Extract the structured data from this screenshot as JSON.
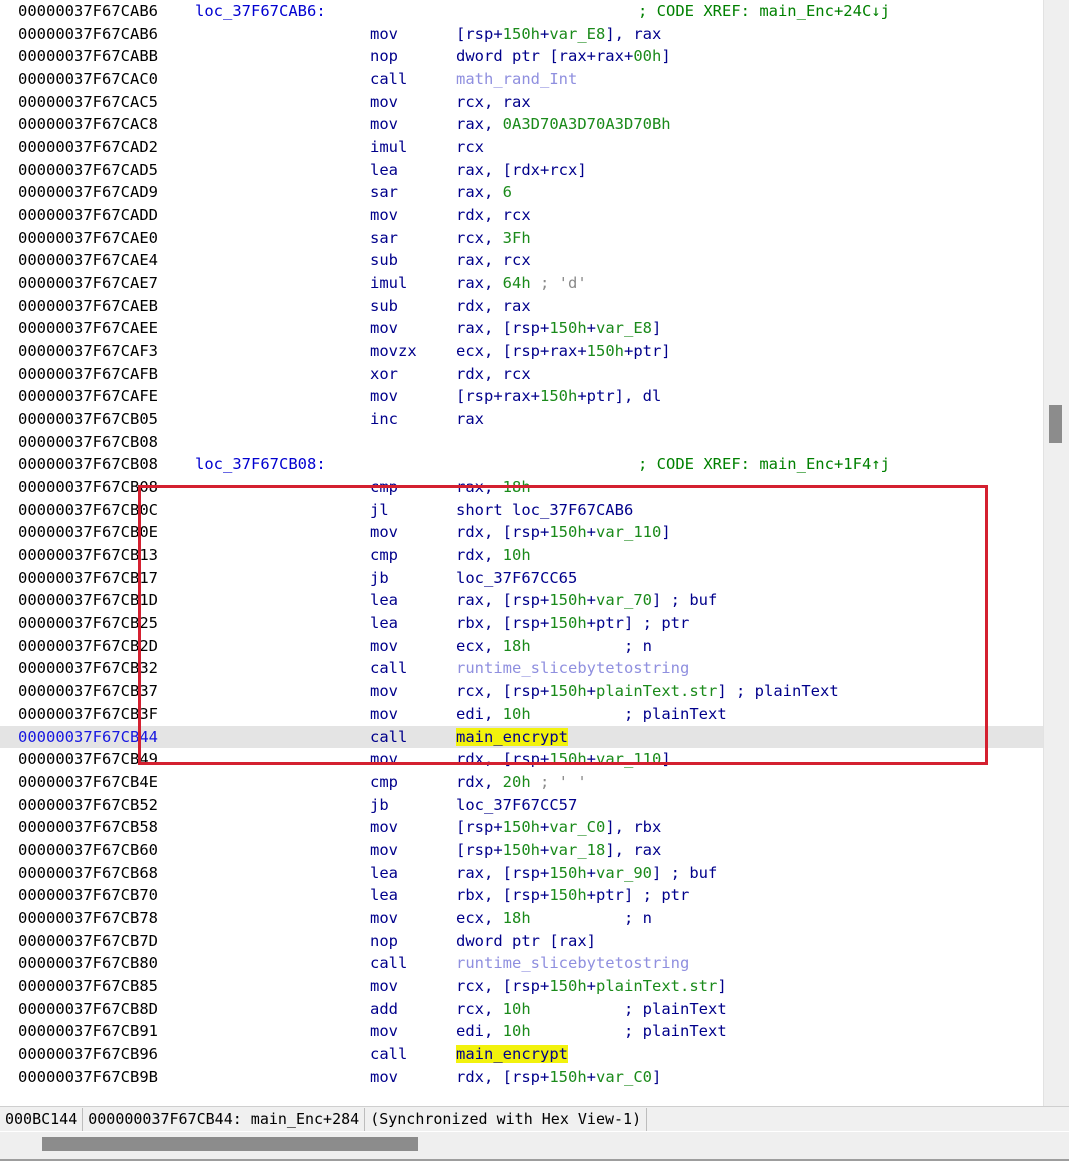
{
  "window": {
    "kind": "disassembly-listing"
  },
  "statusbar": {
    "file_offset": "000BC144",
    "location": "000000037F67CB44: main_Enc+284",
    "sync": "(Synchronized with Hex View-1)"
  },
  "annotation": {
    "box_color": "#d42030",
    "highlight_color": "#f2f20d",
    "current_line_color": "#e4e4e4"
  },
  "listing": [
    {
      "addr": "00000037F67CAB6",
      "label": "loc_37F67CAB6:",
      "mnem": "",
      "ops": "",
      "xref": "; CODE XREF: main_Enc+24C↓j"
    },
    {
      "addr": "00000037F67CAB6",
      "label": "",
      "mnem": "mov",
      "ops": "[rsp+150h+var_E8], rax",
      "xref": ""
    },
    {
      "addr": "00000037F67CABB",
      "label": "",
      "mnem": "nop",
      "ops": "dword ptr [rax+rax+00h]",
      "xref": ""
    },
    {
      "addr": "00000037F67CAC0",
      "label": "",
      "mnem": "call",
      "ops": "math_rand_Int",
      "xref": "",
      "optype": "ext"
    },
    {
      "addr": "00000037F67CAC5",
      "label": "",
      "mnem": "mov",
      "ops": "rcx, rax",
      "xref": ""
    },
    {
      "addr": "00000037F67CAC8",
      "label": "",
      "mnem": "mov",
      "ops": "rax, 0A3D70A3D70A3D70Bh",
      "xref": ""
    },
    {
      "addr": "00000037F67CAD2",
      "label": "",
      "mnem": "imul",
      "ops": "rcx",
      "xref": ""
    },
    {
      "addr": "00000037F67CAD5",
      "label": "",
      "mnem": "lea",
      "ops": "rax, [rdx+rcx]",
      "xref": ""
    },
    {
      "addr": "00000037F67CAD9",
      "label": "",
      "mnem": "sar",
      "ops": "rax, 6",
      "xref": ""
    },
    {
      "addr": "00000037F67CADD",
      "label": "",
      "mnem": "mov",
      "ops": "rdx, rcx",
      "xref": ""
    },
    {
      "addr": "00000037F67CAE0",
      "label": "",
      "mnem": "sar",
      "ops": "rcx, 3Fh",
      "xref": ""
    },
    {
      "addr": "00000037F67CAE4",
      "label": "",
      "mnem": "sub",
      "ops": "rax, rcx",
      "xref": ""
    },
    {
      "addr": "00000037F67CAE7",
      "label": "",
      "mnem": "imul",
      "ops": "rax, 64h ; 'd'",
      "xref": ""
    },
    {
      "addr": "00000037F67CAEB",
      "label": "",
      "mnem": "sub",
      "ops": "rdx, rax",
      "xref": ""
    },
    {
      "addr": "00000037F67CAEE",
      "label": "",
      "mnem": "mov",
      "ops": "rax, [rsp+150h+var_E8]",
      "xref": ""
    },
    {
      "addr": "00000037F67CAF3",
      "label": "",
      "mnem": "movzx",
      "ops": "ecx, [rsp+rax+150h+ptr]",
      "xref": ""
    },
    {
      "addr": "00000037F67CAFB",
      "label": "",
      "mnem": "xor",
      "ops": "rdx, rcx",
      "xref": ""
    },
    {
      "addr": "00000037F67CAFE",
      "label": "",
      "mnem": "mov",
      "ops": "[rsp+rax+150h+ptr], dl",
      "xref": ""
    },
    {
      "addr": "00000037F67CB05",
      "label": "",
      "mnem": "inc",
      "ops": "rax",
      "xref": ""
    },
    {
      "addr": "00000037F67CB08",
      "label": "",
      "mnem": "",
      "ops": "",
      "xref": ""
    },
    {
      "addr": "00000037F67CB08",
      "label": "loc_37F67CB08:",
      "mnem": "",
      "ops": "",
      "xref": "; CODE XREF: main_Enc+1F4↑j"
    },
    {
      "addr": "00000037F67CB08",
      "label": "",
      "mnem": "cmp",
      "ops": "rax, 18h",
      "xref": ""
    },
    {
      "addr": "00000037F67CB0C",
      "label": "",
      "mnem": "jl",
      "ops": "short loc_37F67CAB6",
      "xref": ""
    },
    {
      "addr": "00000037F67CB0E",
      "label": "",
      "mnem": "mov",
      "ops": "rdx, [rsp+150h+var_110]",
      "xref": ""
    },
    {
      "addr": "00000037F67CB13",
      "label": "",
      "mnem": "cmp",
      "ops": "rdx, 10h",
      "xref": ""
    },
    {
      "addr": "00000037F67CB17",
      "label": "",
      "mnem": "jb",
      "ops": "loc_37F67CC65",
      "xref": ""
    },
    {
      "addr": "00000037F67CB1D",
      "label": "",
      "mnem": "lea",
      "ops": "rax, [rsp+150h+var_70] ; buf",
      "xref": ""
    },
    {
      "addr": "00000037F67CB25",
      "label": "",
      "mnem": "lea",
      "ops": "rbx, [rsp+150h+ptr] ; ptr",
      "xref": ""
    },
    {
      "addr": "00000037F67CB2D",
      "label": "",
      "mnem": "mov",
      "ops": "ecx, 18h          ; n",
      "xref": ""
    },
    {
      "addr": "00000037F67CB32",
      "label": "",
      "mnem": "call",
      "ops": "runtime_slicebytetostring",
      "xref": "",
      "optype": "ext"
    },
    {
      "addr": "00000037F67CB37",
      "label": "",
      "mnem": "mov",
      "ops": "rcx, [rsp+150h+plainText.str] ; plainText",
      "xref": ""
    },
    {
      "addr": "00000037F67CB3F",
      "label": "",
      "mnem": "mov",
      "ops": "edi, 10h          ; plainText",
      "xref": ""
    },
    {
      "addr": "00000037F67CB44",
      "label": "",
      "mnem": "call",
      "ops": "main_encrypt",
      "xref": "",
      "optype": "highlight",
      "current": true
    },
    {
      "addr": "00000037F67CB49",
      "label": "",
      "mnem": "mov",
      "ops": "rdx, [rsp+150h+var_110]",
      "xref": ""
    },
    {
      "addr": "00000037F67CB4E",
      "label": "",
      "mnem": "cmp",
      "ops": "rdx, 20h ; ' '",
      "xref": ""
    },
    {
      "addr": "00000037F67CB52",
      "label": "",
      "mnem": "jb",
      "ops": "loc_37F67CC57",
      "xref": ""
    },
    {
      "addr": "00000037F67CB58",
      "label": "",
      "mnem": "mov",
      "ops": "[rsp+150h+var_C0], rbx",
      "xref": ""
    },
    {
      "addr": "00000037F67CB60",
      "label": "",
      "mnem": "mov",
      "ops": "[rsp+150h+var_18], rax",
      "xref": ""
    },
    {
      "addr": "00000037F67CB68",
      "label": "",
      "mnem": "lea",
      "ops": "rax, [rsp+150h+var_90] ; buf",
      "xref": ""
    },
    {
      "addr": "00000037F67CB70",
      "label": "",
      "mnem": "lea",
      "ops": "rbx, [rsp+150h+ptr] ; ptr",
      "xref": ""
    },
    {
      "addr": "00000037F67CB78",
      "label": "",
      "mnem": "mov",
      "ops": "ecx, 18h          ; n",
      "xref": ""
    },
    {
      "addr": "00000037F67CB7D",
      "label": "",
      "mnem": "nop",
      "ops": "dword ptr [rax]",
      "xref": ""
    },
    {
      "addr": "00000037F67CB80",
      "label": "",
      "mnem": "call",
      "ops": "runtime_slicebytetostring",
      "xref": "",
      "optype": "ext"
    },
    {
      "addr": "00000037F67CB85",
      "label": "",
      "mnem": "mov",
      "ops": "rcx, [rsp+150h+plainText.str]",
      "xref": ""
    },
    {
      "addr": "00000037F67CB8D",
      "label": "",
      "mnem": "add",
      "ops": "rcx, 10h          ; plainText",
      "xref": ""
    },
    {
      "addr": "00000037F67CB91",
      "label": "",
      "mnem": "mov",
      "ops": "edi, 10h          ; plainText",
      "xref": ""
    },
    {
      "addr": "00000037F67CB96",
      "label": "",
      "mnem": "call",
      "ops": "main_encrypt",
      "xref": "",
      "optype": "highlight"
    },
    {
      "addr": "00000037F67CB9B",
      "label": "",
      "mnem": "mov",
      "ops": "rdx, [rsp+150h+var_C0]",
      "xref": ""
    }
  ]
}
